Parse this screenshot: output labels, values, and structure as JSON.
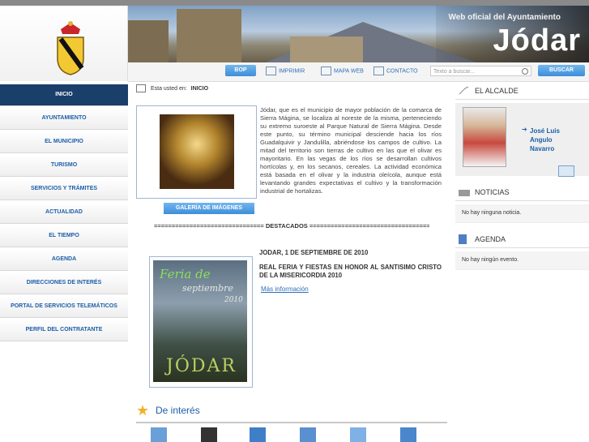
{
  "header": {
    "tagline": "Web oficial del Ayuntamiento",
    "town_name": "Jódar"
  },
  "toolbar": {
    "bop": "BOP",
    "print": "IMPRIMIR",
    "map": "MAPA WEB",
    "contact": "CONTACTO",
    "search_placeholder": "Texto a buscar...",
    "search_button": "BUSCAR"
  },
  "sidebar": {
    "items": [
      {
        "label": "INICIO"
      },
      {
        "label": "AYUNTAMIENTO"
      },
      {
        "label": "EL MUNICIPIO"
      },
      {
        "label": "TURISMO"
      },
      {
        "label": "SERVICIOS Y TRÁMITES"
      },
      {
        "label": "ACTUALIDAD"
      },
      {
        "label": "EL TIEMPO"
      },
      {
        "label": "AGENDA"
      },
      {
        "label": "DIRECCIONES DE INTERÉS"
      },
      {
        "label": "PORTAL DE SERVICIOS TELEMÁTICOS"
      },
      {
        "label": "PERFIL DEL CONTRATANTE"
      }
    ]
  },
  "breadcrumb": {
    "prefix": "Esta usted en:",
    "current": "INICIO"
  },
  "main": {
    "gallery_button": "GALERÍA DE IMÁGENES",
    "intro": "Jódar, que es el municipio de mayor población de la comarca de Sierra Mágina, se localiza al noreste de la misma, perteneciendo su extremo suroeste al Parque Natural de Sierra Mágina. Desde este punto, su término municipal desciende hacia los ríos Guadalquivir y Jandulilla, abriéndose los campos de cultivo. La mitad del territorio son tierras de cultivo en las que el olivar es mayoritario. En las vegas de los ríos se desarrollan cultivos hortícolas y, en los secanos, cereales. La actividad económica está basada en el olivar y la industria oleícola, aunque está levantando grandes expectativas el cultivo y la transformación industrial de hortalizas.",
    "destacados": "=============================== DESTACADOS ===================================",
    "news": {
      "date": "JODAR, 1 DE SEPTIEMBRE DE 2010",
      "title": "REAL FERIA Y FIESTAS EN HONOR AL SANTISIMO CRISTO DE LA MISERICORDIA 2010",
      "more": "Más información",
      "poster_line1": "Feria de",
      "poster_line2": "septiembre",
      "poster_year": "2010",
      "poster_town": "JÓDAR"
    },
    "interes_title": "De interés"
  },
  "right": {
    "mayor_title": "EL ALCALDE",
    "mayor_name_1": "José Luis",
    "mayor_name_2": "Angulo",
    "mayor_name_3": "Navarro",
    "news_title": "NOTICIAS",
    "news_empty": "No hay ninguna noticia.",
    "agenda_title": "AGENDA",
    "agenda_empty": "No hay ningún evento."
  }
}
